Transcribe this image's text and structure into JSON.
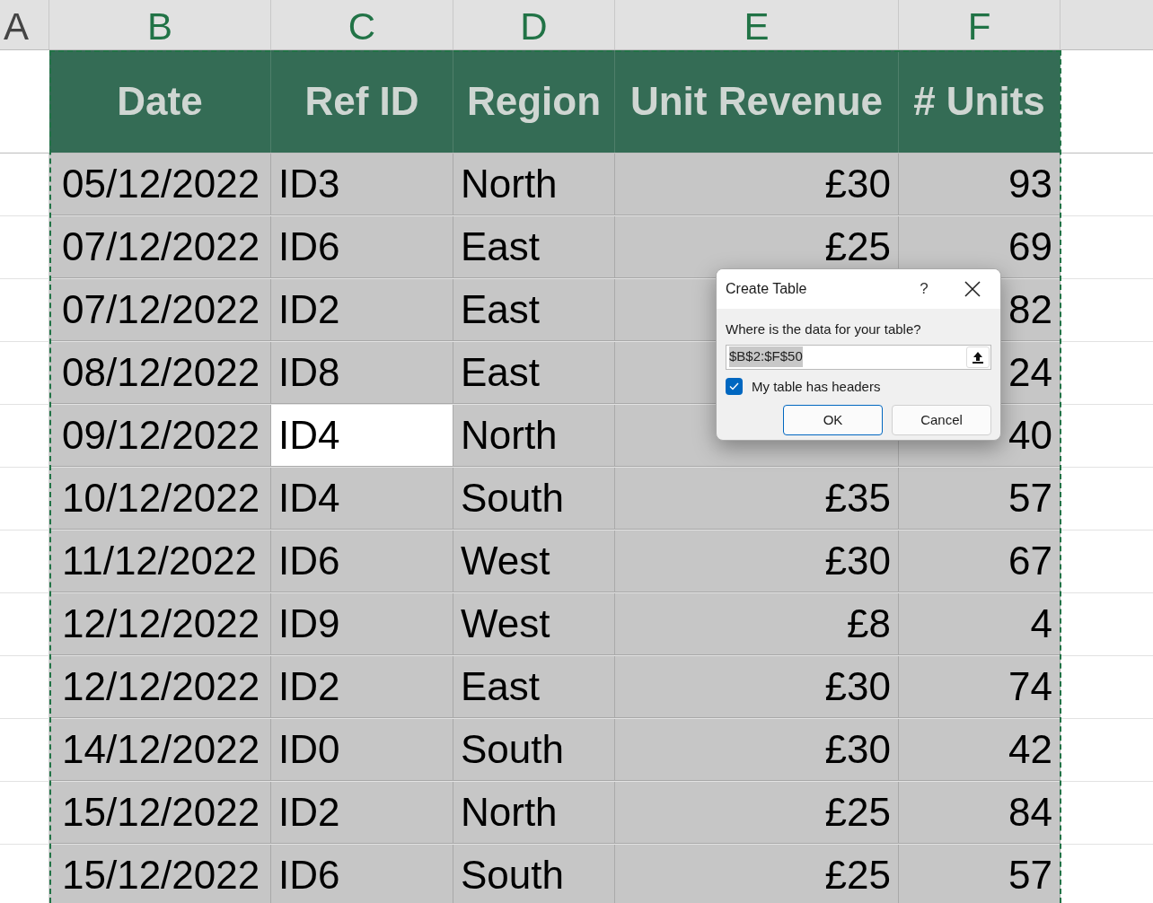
{
  "column_headers": [
    "A",
    "B",
    "C",
    "D",
    "E",
    "F"
  ],
  "table": {
    "columns": [
      "Date",
      "Ref ID",
      "Region",
      "Unit Revenue",
      "# Units"
    ],
    "rows": [
      {
        "date": "05/12/2022",
        "ref_id": "ID3",
        "region": "North",
        "unit_revenue": "£30",
        "units": "93",
        "selected": false
      },
      {
        "date": "07/12/2022",
        "ref_id": "ID6",
        "region": "East",
        "unit_revenue": "£25",
        "units": "69",
        "selected": false
      },
      {
        "date": "07/12/2022",
        "ref_id": "ID2",
        "region": "East",
        "units": "82",
        "selected": false
      },
      {
        "date": "08/12/2022",
        "ref_id": "ID8",
        "region": "East",
        "units": "24",
        "selected": false
      },
      {
        "date": "09/12/2022",
        "ref_id": "ID4",
        "region": "North",
        "units": "40",
        "selected": true
      },
      {
        "date": "10/12/2022",
        "ref_id": "ID4",
        "region": "South",
        "unit_revenue": "£35",
        "units": "57",
        "selected": false
      },
      {
        "date": "11/12/2022",
        "ref_id": "ID6",
        "region": "West",
        "unit_revenue": "£30",
        "units": "67",
        "selected": false
      },
      {
        "date": "12/12/2022",
        "ref_id": "ID9",
        "region": "West",
        "unit_revenue": "£8",
        "units": "4",
        "selected": false
      },
      {
        "date": "12/12/2022",
        "ref_id": "ID2",
        "region": "East",
        "unit_revenue": "£30",
        "units": "74",
        "selected": false
      },
      {
        "date": "14/12/2022",
        "ref_id": "ID0",
        "region": "South",
        "unit_revenue": "£30",
        "units": "42",
        "selected": false
      },
      {
        "date": "15/12/2022",
        "ref_id": "ID2",
        "region": "North",
        "unit_revenue": "£25",
        "units": "84",
        "selected": false
      },
      {
        "date": "15/12/2022",
        "ref_id": "ID6",
        "region": "South",
        "unit_revenue": "£25",
        "units": "57",
        "selected": false
      }
    ]
  },
  "dialog": {
    "title": "Create Table",
    "help": "?",
    "prompt": "Where is the data for your table?",
    "range_value": "$B$2:$F$50",
    "headers_checkbox": {
      "label": "My table has headers",
      "checked": true
    },
    "buttons": [
      "OK",
      "Cancel"
    ]
  }
}
